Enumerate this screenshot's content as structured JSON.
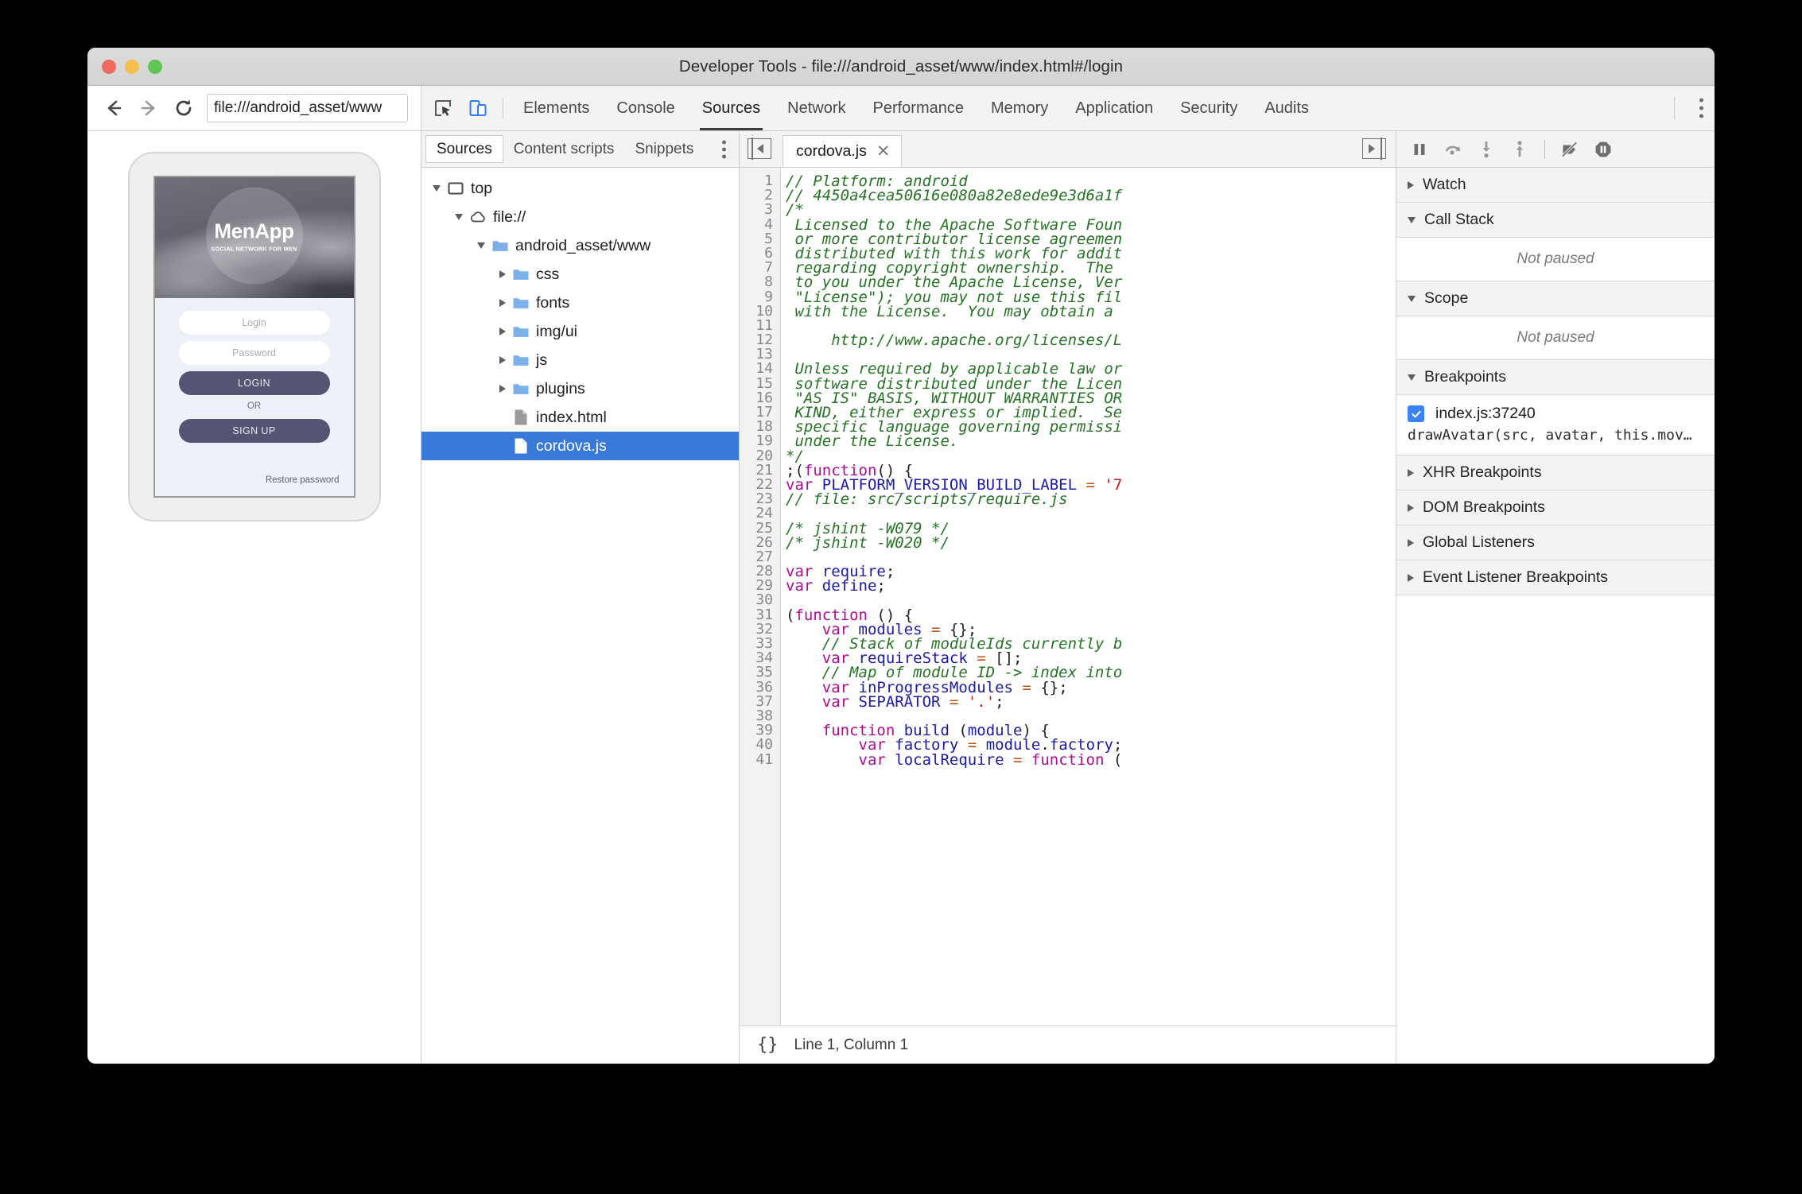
{
  "window": {
    "title": "Developer Tools - file:///android_asset/www/index.html#/login"
  },
  "browser": {
    "back_icon": "back-arrow-icon",
    "forward_icon": "forward-arrow-icon",
    "reload_icon": "reload-icon",
    "url_value": "file:///android_asset/www"
  },
  "devtools": {
    "inspect_icon": "inspect-element-icon",
    "device_icon": "toggle-device-toolbar-icon",
    "tabs": [
      {
        "label": "Elements",
        "active": false
      },
      {
        "label": "Console",
        "active": false
      },
      {
        "label": "Sources",
        "active": true
      },
      {
        "label": "Network",
        "active": false
      },
      {
        "label": "Performance",
        "active": false
      },
      {
        "label": "Memory",
        "active": false
      },
      {
        "label": "Application",
        "active": false
      },
      {
        "label": "Security",
        "active": false
      },
      {
        "label": "Audits",
        "active": false
      }
    ],
    "more_icon": "kebab-menu-icon"
  },
  "preview": {
    "app_name": "MenApp",
    "app_tagline": "SOCIAL NETWORK FOR MEN",
    "login_placeholder": "Login",
    "password_placeholder": "Password",
    "login_button": "LOGIN",
    "or_label": "OR",
    "signup_button": "SIGN UP",
    "restore_link": "Restore password"
  },
  "navigator": {
    "tabs": [
      {
        "label": "Sources",
        "active": true
      },
      {
        "label": "Content scripts",
        "active": false
      },
      {
        "label": "Snippets",
        "active": false
      }
    ],
    "more_icon": "kebab-menu-icon",
    "tree": [
      {
        "label": "top",
        "indent": 0,
        "icon": "frame-icon",
        "arrow": "open",
        "selected": false
      },
      {
        "label": "file://",
        "indent": 1,
        "icon": "cloud-icon",
        "arrow": "open",
        "selected": false
      },
      {
        "label": "android_asset/www",
        "indent": 2,
        "icon": "folder-icon",
        "arrow": "open",
        "selected": false
      },
      {
        "label": "css",
        "indent": 3,
        "icon": "folder-icon",
        "arrow": "closed",
        "selected": false
      },
      {
        "label": "fonts",
        "indent": 3,
        "icon": "folder-icon",
        "arrow": "closed",
        "selected": false
      },
      {
        "label": "img/ui",
        "indent": 3,
        "icon": "folder-icon",
        "arrow": "closed",
        "selected": false
      },
      {
        "label": "js",
        "indent": 3,
        "icon": "folder-icon",
        "arrow": "closed",
        "selected": false
      },
      {
        "label": "plugins",
        "indent": 3,
        "icon": "folder-icon",
        "arrow": "closed",
        "selected": false
      },
      {
        "label": "index.html",
        "indent": 3,
        "icon": "file-gray-icon",
        "arrow": "none",
        "selected": false
      },
      {
        "label": "cordova.js",
        "indent": 3,
        "icon": "file-white-icon",
        "arrow": "none",
        "selected": true
      }
    ]
  },
  "editor": {
    "prev_icon": "show-navigator-icon",
    "next_icon": "show-debugger-icon",
    "file_tab": "cordova.js",
    "close_icon": "close-icon",
    "status_icon": "pretty-print-icon",
    "status_text": "Line 1, Column 1",
    "code_lines": [
      {
        "n": 1,
        "tokens": [
          [
            "cm",
            "// Platform: android"
          ]
        ]
      },
      {
        "n": 2,
        "tokens": [
          [
            "cm",
            "// 4450a4cea50616e080a82e8ede9e3d6a1f"
          ]
        ]
      },
      {
        "n": 3,
        "tokens": [
          [
            "cm",
            "/*"
          ]
        ]
      },
      {
        "n": 4,
        "tokens": [
          [
            "cm",
            " Licensed to the Apache Software Foun"
          ]
        ]
      },
      {
        "n": 5,
        "tokens": [
          [
            "cm",
            " or more contributor license agreemen"
          ]
        ]
      },
      {
        "n": 6,
        "tokens": [
          [
            "cm",
            " distributed with this work for addit"
          ]
        ]
      },
      {
        "n": 7,
        "tokens": [
          [
            "cm",
            " regarding copyright ownership.  The "
          ]
        ]
      },
      {
        "n": 8,
        "tokens": [
          [
            "cm",
            " to you under the Apache License, Ver"
          ]
        ]
      },
      {
        "n": 9,
        "tokens": [
          [
            "cm",
            " \"License\"); you may not use this fil"
          ]
        ]
      },
      {
        "n": 10,
        "tokens": [
          [
            "cm",
            " with the License.  You may obtain a "
          ]
        ]
      },
      {
        "n": 11,
        "tokens": [
          [
            "cm",
            ""
          ]
        ]
      },
      {
        "n": 12,
        "tokens": [
          [
            "cm",
            "     http://www.apache.org/licenses/L"
          ]
        ]
      },
      {
        "n": 13,
        "tokens": [
          [
            "cm",
            ""
          ]
        ]
      },
      {
        "n": 14,
        "tokens": [
          [
            "cm",
            " Unless required by applicable law or"
          ]
        ]
      },
      {
        "n": 15,
        "tokens": [
          [
            "cm",
            " software distributed under the Licen"
          ]
        ]
      },
      {
        "n": 16,
        "tokens": [
          [
            "cm",
            " \"AS IS\" BASIS, WITHOUT WARRANTIES OR"
          ]
        ]
      },
      {
        "n": 17,
        "tokens": [
          [
            "cm",
            " KIND, either express or implied.  Se"
          ]
        ]
      },
      {
        "n": 18,
        "tokens": [
          [
            "cm",
            " specific language governing permissi"
          ]
        ]
      },
      {
        "n": 19,
        "tokens": [
          [
            "cm",
            " under the License."
          ]
        ]
      },
      {
        "n": 20,
        "tokens": [
          [
            "cm",
            "*/"
          ]
        ]
      },
      {
        "n": 21,
        "tokens": [
          [
            "pl",
            ";("
          ],
          [
            "kw",
            "function"
          ],
          [
            "pl",
            "() {"
          ]
        ]
      },
      {
        "n": 22,
        "tokens": [
          [
            "kw",
            "var "
          ],
          [
            "id",
            "PLATFORM_VERSION_BUILD_LABEL"
          ],
          [
            "pl",
            " "
          ],
          [
            "op",
            "="
          ],
          [
            "pl",
            " "
          ],
          [
            "st",
            "'7"
          ]
        ]
      },
      {
        "n": 23,
        "tokens": [
          [
            "cm",
            "// file: src/scripts/require.js"
          ]
        ]
      },
      {
        "n": 24,
        "tokens": [
          [
            "pl",
            ""
          ]
        ]
      },
      {
        "n": 25,
        "tokens": [
          [
            "cm",
            "/* jshint -W079 */"
          ]
        ]
      },
      {
        "n": 26,
        "tokens": [
          [
            "cm",
            "/* jshint -W020 */"
          ]
        ]
      },
      {
        "n": 27,
        "tokens": [
          [
            "pl",
            ""
          ]
        ]
      },
      {
        "n": 28,
        "tokens": [
          [
            "kw",
            "var "
          ],
          [
            "id",
            "require"
          ],
          [
            "pl",
            ";"
          ]
        ]
      },
      {
        "n": 29,
        "tokens": [
          [
            "kw",
            "var "
          ],
          [
            "id",
            "define"
          ],
          [
            "pl",
            ";"
          ]
        ]
      },
      {
        "n": 30,
        "tokens": [
          [
            "pl",
            ""
          ]
        ]
      },
      {
        "n": 31,
        "tokens": [
          [
            "pl",
            "("
          ],
          [
            "kw",
            "function"
          ],
          [
            "pl",
            " () {"
          ]
        ]
      },
      {
        "n": 32,
        "tokens": [
          [
            "pl",
            "    "
          ],
          [
            "kw",
            "var "
          ],
          [
            "id",
            "modules"
          ],
          [
            "pl",
            " "
          ],
          [
            "op",
            "="
          ],
          [
            "pl",
            " {};"
          ]
        ]
      },
      {
        "n": 33,
        "tokens": [
          [
            "pl",
            "    "
          ],
          [
            "cm",
            "// Stack of moduleIds currently b"
          ]
        ]
      },
      {
        "n": 34,
        "tokens": [
          [
            "pl",
            "    "
          ],
          [
            "kw",
            "var "
          ],
          [
            "id",
            "requireStack"
          ],
          [
            "pl",
            " "
          ],
          [
            "op",
            "="
          ],
          [
            "pl",
            " [];"
          ]
        ]
      },
      {
        "n": 35,
        "tokens": [
          [
            "pl",
            "    "
          ],
          [
            "cm",
            "// Map of module ID -> index into"
          ]
        ]
      },
      {
        "n": 36,
        "tokens": [
          [
            "pl",
            "    "
          ],
          [
            "kw",
            "var "
          ],
          [
            "id",
            "inProgressModules"
          ],
          [
            "pl",
            " "
          ],
          [
            "op",
            "="
          ],
          [
            "pl",
            " {};"
          ]
        ]
      },
      {
        "n": 37,
        "tokens": [
          [
            "pl",
            "    "
          ],
          [
            "kw",
            "var "
          ],
          [
            "id",
            "SEPARATOR"
          ],
          [
            "pl",
            " "
          ],
          [
            "op",
            "="
          ],
          [
            "pl",
            " "
          ],
          [
            "st",
            "'.'"
          ],
          [
            "pl",
            ";"
          ]
        ]
      },
      {
        "n": 38,
        "tokens": [
          [
            "pl",
            ""
          ]
        ]
      },
      {
        "n": 39,
        "tokens": [
          [
            "pl",
            "    "
          ],
          [
            "kw",
            "function"
          ],
          [
            "pl",
            " "
          ],
          [
            "id",
            "build"
          ],
          [
            "pl",
            " ("
          ],
          [
            "id",
            "module"
          ],
          [
            "pl",
            ") {"
          ]
        ]
      },
      {
        "n": 40,
        "tokens": [
          [
            "pl",
            "        "
          ],
          [
            "kw",
            "var "
          ],
          [
            "id",
            "factory"
          ],
          [
            "pl",
            " "
          ],
          [
            "op",
            "="
          ],
          [
            "pl",
            " "
          ],
          [
            "id",
            "module"
          ],
          [
            "pl",
            "."
          ],
          [
            "id",
            "factory"
          ],
          [
            "pl",
            ";"
          ]
        ]
      },
      {
        "n": 41,
        "tokens": [
          [
            "pl",
            "        "
          ],
          [
            "kw",
            "var "
          ],
          [
            "id",
            "localRequire"
          ],
          [
            "pl",
            " "
          ],
          [
            "op",
            "="
          ],
          [
            "pl",
            " "
          ],
          [
            "kw",
            "function"
          ],
          [
            "pl",
            " ("
          ]
        ]
      }
    ]
  },
  "debugger": {
    "toolbar": [
      {
        "icon": "resume-pause-icon",
        "name": "pause-script-execution"
      },
      {
        "icon": "step-over-icon",
        "name": "step-over-next-call"
      },
      {
        "icon": "step-into-icon",
        "name": "step-into-next-call"
      },
      {
        "icon": "step-out-icon",
        "name": "step-out-of-current-function"
      },
      {
        "icon": "deactivate-breakpoints-icon",
        "name": "deactivate-breakpoints"
      },
      {
        "icon": "pause-on-exceptions-icon",
        "name": "pause-on-exceptions"
      }
    ],
    "sections": [
      {
        "title": "Watch",
        "open": false,
        "body": null
      },
      {
        "title": "Call Stack",
        "open": true,
        "body": "Not paused"
      },
      {
        "title": "Scope",
        "open": true,
        "body": "Not paused"
      },
      {
        "title": "Breakpoints",
        "open": true,
        "body": null
      },
      {
        "title": "XHR Breakpoints",
        "open": false,
        "body": null
      },
      {
        "title": "DOM Breakpoints",
        "open": false,
        "body": null
      },
      {
        "title": "Global Listeners",
        "open": false,
        "body": null
      },
      {
        "title": "Event Listener Breakpoints",
        "open": false,
        "body": null
      }
    ],
    "breakpoint": {
      "checked": true,
      "location": "index.js:37240",
      "snippet": "drawAvatar(src, avatar, this.mov…"
    }
  }
}
